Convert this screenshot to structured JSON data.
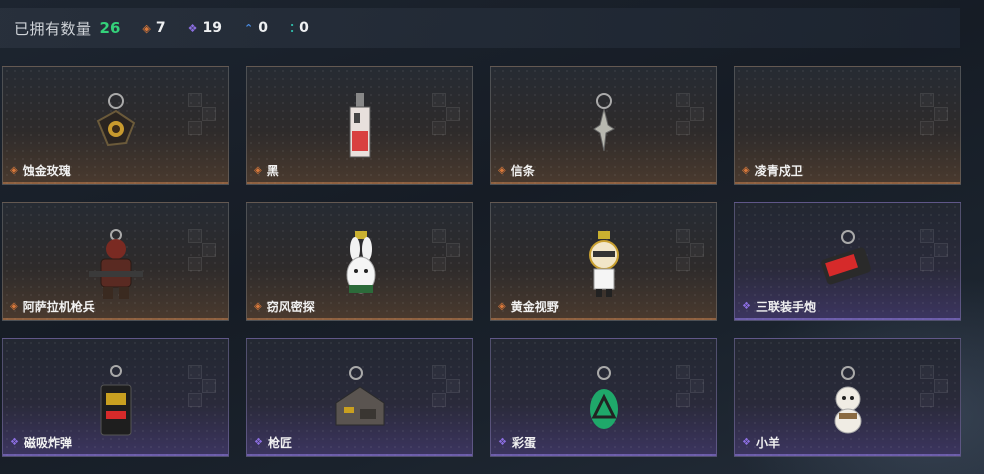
{
  "header": {
    "title": "已拥有数量",
    "total": "26",
    "stats": [
      {
        "icon": "orange-diamond-icon",
        "value": "7"
      },
      {
        "icon": "purple-diamond-icon",
        "value": "19"
      },
      {
        "icon": "blue-chevron-icon",
        "value": "0"
      },
      {
        "icon": "teal-dots-icon",
        "value": "0"
      }
    ]
  },
  "colors": {
    "accent_green": "#34d17a",
    "orange": "#d9783a",
    "purple": "#8b6ee0",
    "blue": "#4a8be0",
    "teal": "#2fb3a3"
  },
  "items": [
    {
      "name": "蚀金玫瑰",
      "rarity": "orange"
    },
    {
      "name": "黑",
      "rarity": "orange"
    },
    {
      "name": "信条",
      "rarity": "orange"
    },
    {
      "name": "凌青戍卫",
      "rarity": "orange"
    },
    {
      "name": "阿萨拉机枪兵",
      "rarity": "orange"
    },
    {
      "name": "窃风密探",
      "rarity": "orange"
    },
    {
      "name": "黄金视野",
      "rarity": "orange"
    },
    {
      "name": "三联装手炮",
      "rarity": "purple"
    },
    {
      "name": "磁吸炸弹",
      "rarity": "purple"
    },
    {
      "name": "枪匠",
      "rarity": "purple"
    },
    {
      "name": "彩蛋",
      "rarity": "purple"
    },
    {
      "name": "小羊",
      "rarity": "purple"
    }
  ]
}
